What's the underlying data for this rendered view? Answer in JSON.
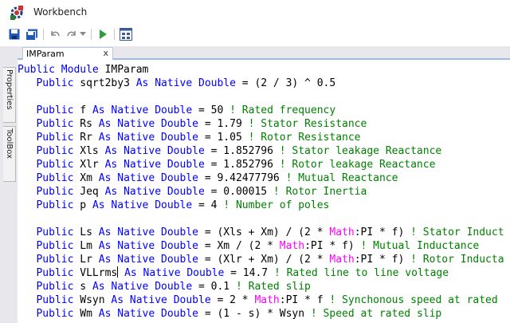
{
  "window": {
    "title": "Workbench"
  },
  "toolbar": {
    "buttons": [
      {
        "name": "save-icon"
      },
      {
        "name": "save-all-icon"
      },
      {
        "name": "undo-icon"
      },
      {
        "name": "redo-icon"
      },
      {
        "name": "redo-dropdown-icon"
      },
      {
        "name": "run-icon"
      },
      {
        "name": "toggle-view-icon"
      }
    ]
  },
  "side_tabs": [
    {
      "label": "Properties"
    },
    {
      "label": "ToolBox"
    }
  ],
  "editor_tab": {
    "label": "IMParam",
    "close": "x"
  },
  "code": {
    "l1": {
      "a": "Public Module",
      "b": " IMParam"
    },
    "l2": {
      "ind": "   ",
      "a": "Public",
      "b": " sqrt2by3 ",
      "c": "As Native Double",
      "d": " = (2 / 3) ^ 0.5"
    },
    "l4": {
      "ind": "   ",
      "a": "Public",
      "b": " f ",
      "c": "As Native Double",
      "d": " = 50 ",
      "e": "! Rated frequency"
    },
    "l5": {
      "ind": "   ",
      "a": "Public",
      "b": " Rs ",
      "c": "As Native Double",
      "d": " = 1.79 ",
      "e": "! Stator Resistance"
    },
    "l6": {
      "ind": "   ",
      "a": "Public",
      "b": " Rr ",
      "c": "As Native Double",
      "d": " = 1.05 ",
      "e": "! Rotor Resistance"
    },
    "l7": {
      "ind": "   ",
      "a": "Public",
      "b": " Xls ",
      "c": "As Native Double",
      "d": " = 1.852796 ",
      "e": "! Stator leakage Reactance"
    },
    "l8": {
      "ind": "   ",
      "a": "Public",
      "b": " Xlr ",
      "c": "As Native Double",
      "d": " = 1.852796 ",
      "e": "! Rotor leakage Reactance"
    },
    "l9": {
      "ind": "   ",
      "a": "Public",
      "b": " Xm ",
      "c": "As Native Double",
      "d": " = 9.42477796 ",
      "e": "! Mutual Reactance"
    },
    "l10": {
      "ind": "   ",
      "a": "Public",
      "b": " Jeq ",
      "c": "As Native Double",
      "d": " = 0.00015 ",
      "e": "! Rotor Inertia"
    },
    "l11": {
      "ind": "   ",
      "a": "Public",
      "b": " p ",
      "c": "As Native Double",
      "d": " = 4 ",
      "e": "! Number of poles"
    },
    "l13": {
      "ind": "   ",
      "a": "Public",
      "b": " Ls ",
      "c": "As Native Double",
      "d": " = (Xls + Xm) / (2 * ",
      "m": "Math",
      "f": ":PI * f) ",
      "e": "! Stator Induct"
    },
    "l14": {
      "ind": "   ",
      "a": "Public",
      "b": " Lm ",
      "c": "As Native Double",
      "d": " = Xm / (2 * ",
      "m": "Math",
      "f": ":PI * f) ",
      "e": "! Mutual Inductance"
    },
    "l15": {
      "ind": "   ",
      "a": "Public",
      "b": " Lr ",
      "c": "As Native Double",
      "d": " = (Xlr + Xm) / (2 * ",
      "m": "Math",
      "f": ":PI * f) ",
      "e": "! Rotor Inducta"
    },
    "l16": {
      "ind": "   ",
      "a": "Public",
      "b": " VLLrms",
      "c": " As Native Double",
      "d": " = 14.7 ",
      "e": "! Rated line to line voltage"
    },
    "l17": {
      "ind": "   ",
      "a": "Public",
      "b": " s ",
      "c": "As Native Double",
      "d": " = 0.1 ",
      "e": "! Rated slip"
    },
    "l18": {
      "ind": "   ",
      "a": "Public",
      "b": " Wsyn ",
      "c": "As Native Double",
      "d": " = 2 * ",
      "m": "Math",
      "f": ":PI * f ",
      "e": "! Synchonous speed at rated"
    },
    "l19": {
      "ind": "   ",
      "a": "Public",
      "b": " Wm ",
      "c": "As Native Double",
      "d": " = (1 - s) * Wsyn ",
      "e": "! Speed at rated slip"
    }
  }
}
